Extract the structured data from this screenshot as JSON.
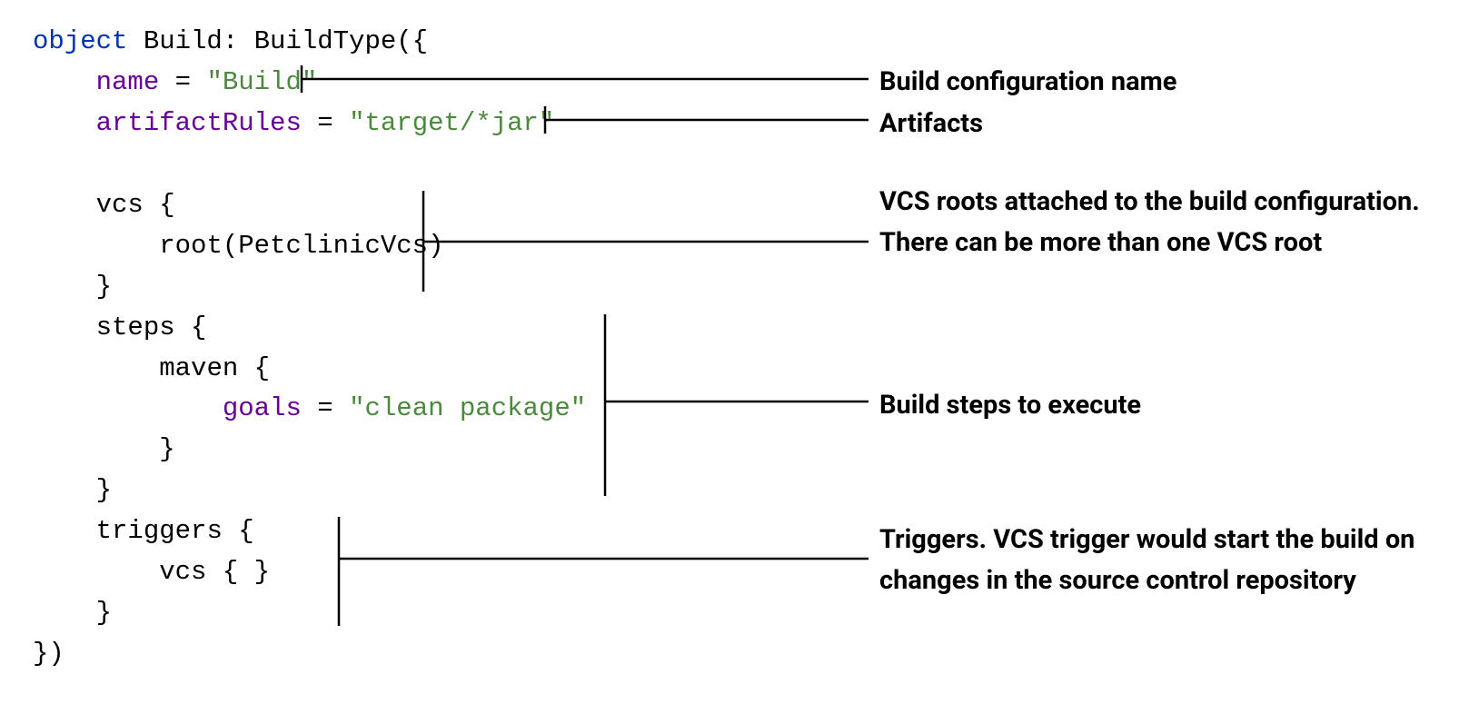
{
  "code": {
    "line1_kw": "object",
    "line1_rest": " Build: BuildType({",
    "line2_indent": "    ",
    "line2_prop": "name",
    "line2_eq": " = ",
    "line2_str": "\"Build\"",
    "line3_indent": "    ",
    "line3_prop": "artifactRules",
    "line3_eq": " = ",
    "line3_str": "\"target/*jar\"",
    "line5_indent": "    ",
    "line5_text": "vcs {",
    "line6_indent": "        ",
    "line6_text": "root(PetclinicVcs)",
    "line7_indent": "    ",
    "line7_text": "}",
    "line8_indent": "    ",
    "line8_text": "steps {",
    "line9_indent": "        ",
    "line9_text": "maven {",
    "line10_indent": "            ",
    "line10_prop": "goals",
    "line10_eq": " = ",
    "line10_str": "\"clean package\"",
    "line11_indent": "        ",
    "line11_text": "}",
    "line12_indent": "    ",
    "line12_text": "}",
    "line13_indent": "    ",
    "line13_text": "triggers {",
    "line14_indent": "        ",
    "line14_text": "vcs { }",
    "line15_indent": "    ",
    "line15_text": "}",
    "line16_text": "})"
  },
  "annotations": {
    "a1": "Build configuration name",
    "a2": "Artifacts",
    "a3": "VCS roots attached to the build configuration. There can be more than one VCS root",
    "a4": "Build steps to execute",
    "a5": "Triggers. VCS trigger would start the build on changes in the source control repository"
  }
}
